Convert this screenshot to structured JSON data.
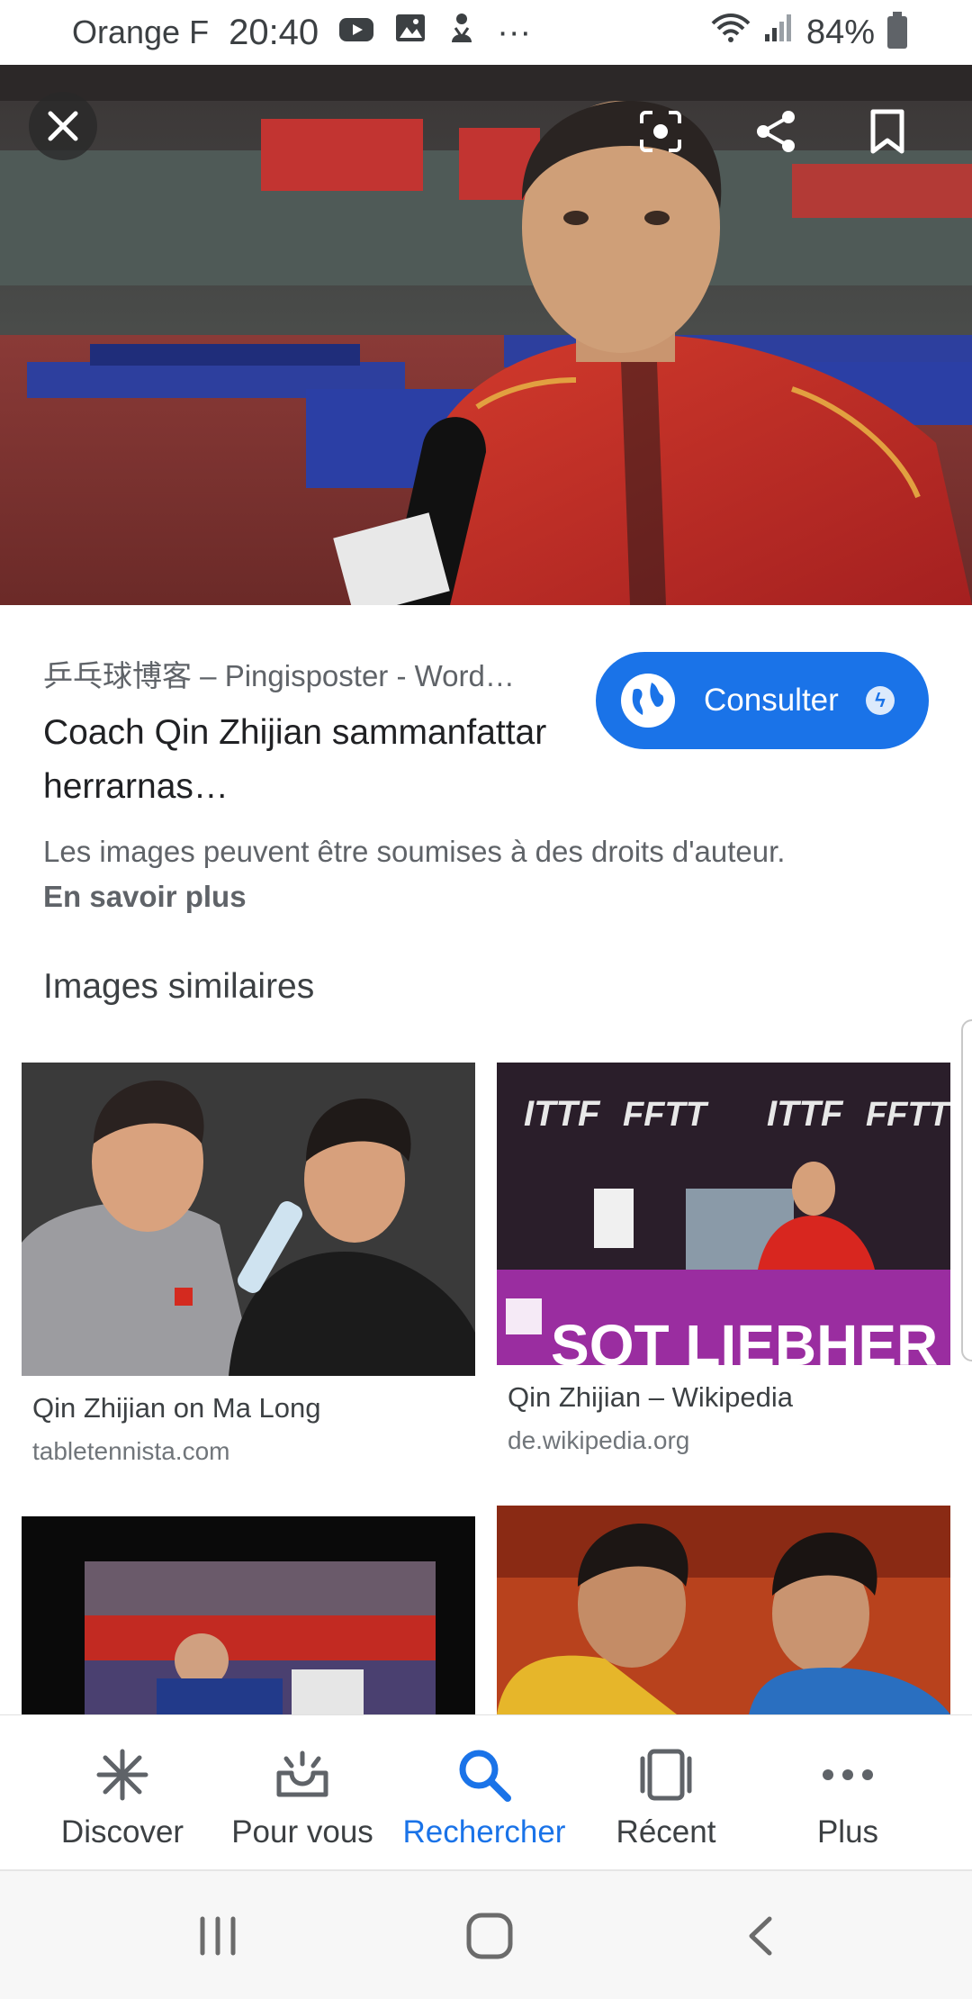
{
  "status_bar": {
    "carrier": "Orange F",
    "time": "20:40",
    "overflow": "···",
    "battery": "84%"
  },
  "hero": {
    "image_desc": "man-in-red-jacket-interview"
  },
  "result": {
    "source": "乒乓球博客 – Pingisposter - Word…",
    "title": "Coach Qin Zhijian sammanfattar herrarnas…",
    "visit_button": "Consulter",
    "copyright_notice": "Les images peuvent être soumises à des droits d'auteur.",
    "learn_more": "En savoir plus"
  },
  "similar": {
    "heading": "Images similaires",
    "items": [
      {
        "title": "Qin Zhijian on Ma Long",
        "domain": "tabletennista.com"
      },
      {
        "title": "Qin Zhijian – Wikipedia",
        "domain": "de.wikipedia.org"
      }
    ]
  },
  "bottom_nav": {
    "items": [
      {
        "label": "Discover",
        "icon": "asterisk-icon"
      },
      {
        "label": "Pour vous",
        "icon": "inbox-icon"
      },
      {
        "label": "Rechercher",
        "icon": "search-icon"
      },
      {
        "label": "Récent",
        "icon": "recent-cards-icon"
      },
      {
        "label": "Plus",
        "icon": "more-dots-icon"
      }
    ],
    "active_index": 2
  },
  "colors": {
    "accent": "#1a73e8",
    "text_primary": "#202124",
    "text_secondary": "#5f6368"
  }
}
